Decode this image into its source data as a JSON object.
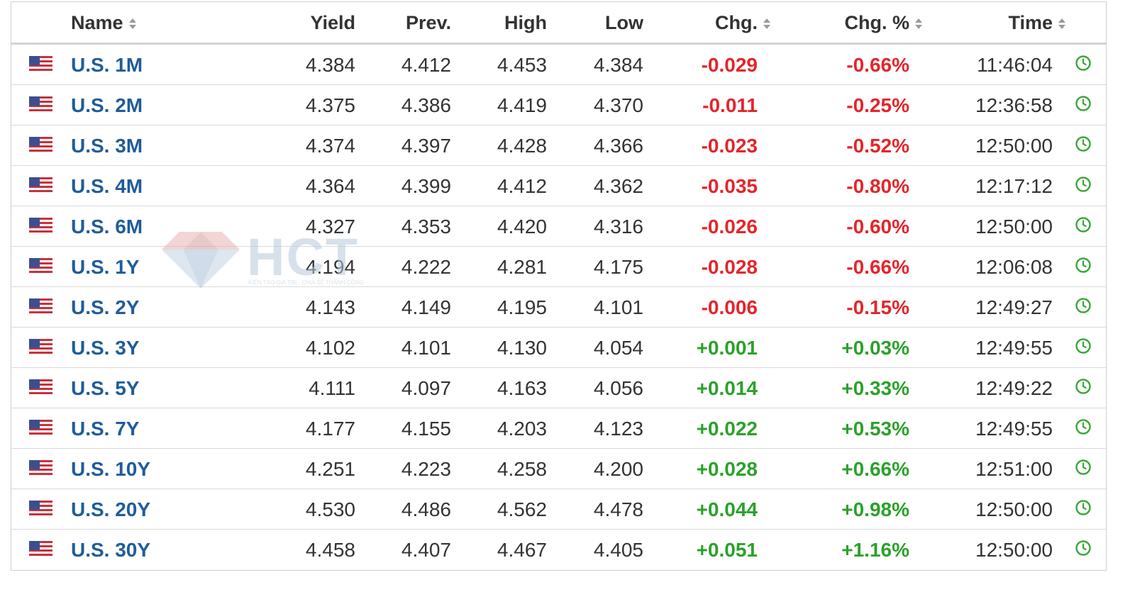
{
  "header": {
    "name": "Name",
    "yield": "Yield",
    "prev": "Prev.",
    "high": "High",
    "low": "Low",
    "chg": "Chg.",
    "chg_pct": "Chg. %",
    "time": "Time"
  },
  "rows": [
    {
      "name": "U.S. 1M",
      "yield": "4.384",
      "prev": "4.412",
      "high": "4.453",
      "low": "4.384",
      "chg": "-0.029",
      "chg_pct": "-0.66%",
      "time": "11:46:04",
      "dir": "neg"
    },
    {
      "name": "U.S. 2M",
      "yield": "4.375",
      "prev": "4.386",
      "high": "4.419",
      "low": "4.370",
      "chg": "-0.011",
      "chg_pct": "-0.25%",
      "time": "12:36:58",
      "dir": "neg"
    },
    {
      "name": "U.S. 3M",
      "yield": "4.374",
      "prev": "4.397",
      "high": "4.428",
      "low": "4.366",
      "chg": "-0.023",
      "chg_pct": "-0.52%",
      "time": "12:50:00",
      "dir": "neg"
    },
    {
      "name": "U.S. 4M",
      "yield": "4.364",
      "prev": "4.399",
      "high": "4.412",
      "low": "4.362",
      "chg": "-0.035",
      "chg_pct": "-0.80%",
      "time": "12:17:12",
      "dir": "neg"
    },
    {
      "name": "U.S. 6M",
      "yield": "4.327",
      "prev": "4.353",
      "high": "4.420",
      "low": "4.316",
      "chg": "-0.026",
      "chg_pct": "-0.60%",
      "time": "12:50:00",
      "dir": "neg"
    },
    {
      "name": "U.S. 1Y",
      "yield": "4.194",
      "prev": "4.222",
      "high": "4.281",
      "low": "4.175",
      "chg": "-0.028",
      "chg_pct": "-0.66%",
      "time": "12:06:08",
      "dir": "neg"
    },
    {
      "name": "U.S. 2Y",
      "yield": "4.143",
      "prev": "4.149",
      "high": "4.195",
      "low": "4.101",
      "chg": "-0.006",
      "chg_pct": "-0.15%",
      "time": "12:49:27",
      "dir": "neg"
    },
    {
      "name": "U.S. 3Y",
      "yield": "4.102",
      "prev": "4.101",
      "high": "4.130",
      "low": "4.054",
      "chg": "+0.001",
      "chg_pct": "+0.03%",
      "time": "12:49:55",
      "dir": "pos"
    },
    {
      "name": "U.S. 5Y",
      "yield": "4.111",
      "prev": "4.097",
      "high": "4.163",
      "low": "4.056",
      "chg": "+0.014",
      "chg_pct": "+0.33%",
      "time": "12:49:22",
      "dir": "pos"
    },
    {
      "name": "U.S. 7Y",
      "yield": "4.177",
      "prev": "4.155",
      "high": "4.203",
      "low": "4.123",
      "chg": "+0.022",
      "chg_pct": "+0.53%",
      "time": "12:49:55",
      "dir": "pos"
    },
    {
      "name": "U.S. 10Y",
      "yield": "4.251",
      "prev": "4.223",
      "high": "4.258",
      "low": "4.200",
      "chg": "+0.028",
      "chg_pct": "+0.66%",
      "time": "12:51:00",
      "dir": "pos"
    },
    {
      "name": "U.S. 20Y",
      "yield": "4.530",
      "prev": "4.486",
      "high": "4.562",
      "low": "4.478",
      "chg": "+0.044",
      "chg_pct": "+0.98%",
      "time": "12:50:00",
      "dir": "pos"
    },
    {
      "name": "U.S. 30Y",
      "yield": "4.458",
      "prev": "4.407",
      "high": "4.467",
      "low": "4.405",
      "chg": "+0.051",
      "chg_pct": "+1.16%",
      "time": "12:50:00",
      "dir": "pos"
    }
  ],
  "watermark": {
    "text": "HCT",
    "tagline": "KIẾN TẠO GIÁ TRỊ - CHIA SẺ THÀNH CÔNG"
  },
  "colors": {
    "negative": "#e4252b",
    "positive": "#2ba12b",
    "name_link": "#1f5c9b",
    "clock": "#3aa63a"
  },
  "icons": {
    "flag": "us-flag-icon",
    "clock": "clock-icon",
    "sort": "sort-icon"
  }
}
